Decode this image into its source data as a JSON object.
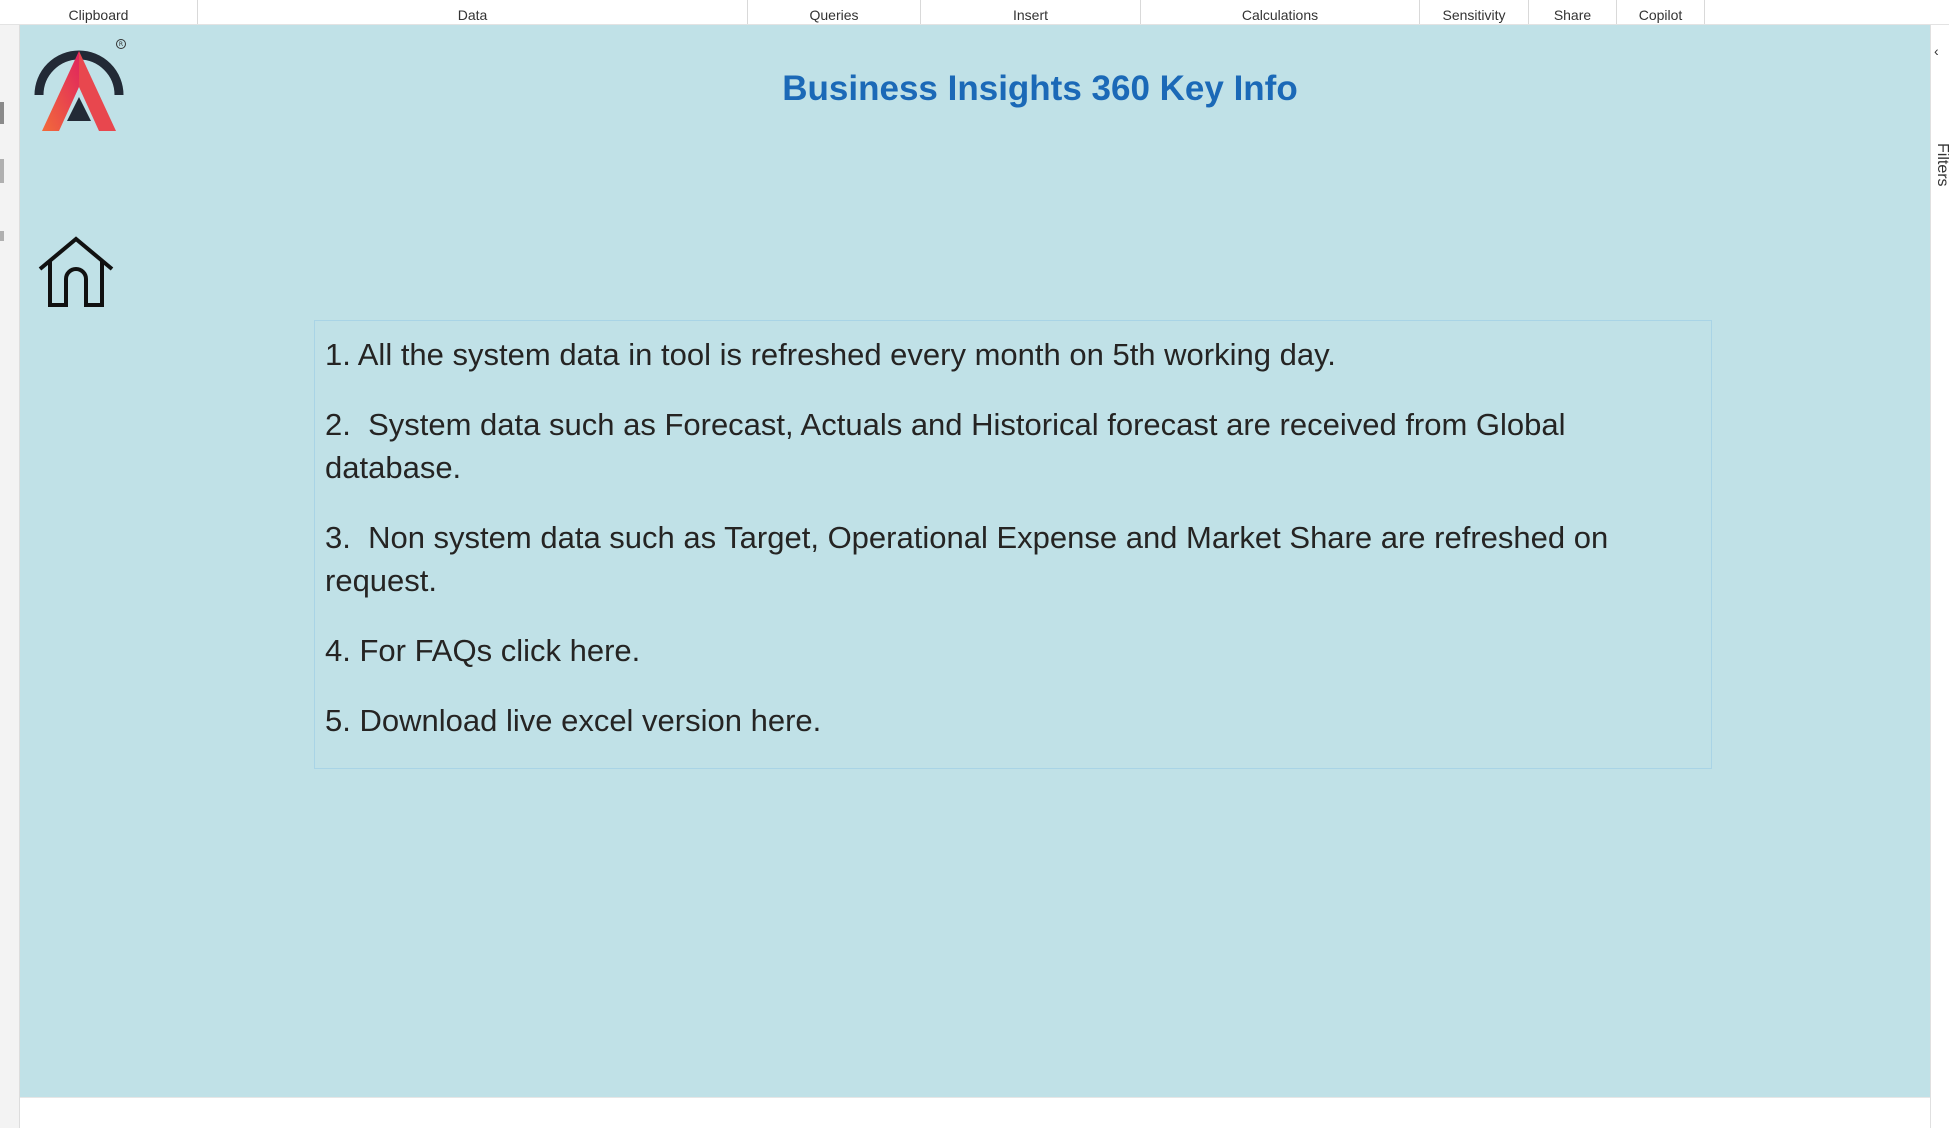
{
  "ribbon": {
    "groups": [
      "Clipboard",
      "Data",
      "Queries",
      "Insert",
      "Calculations",
      "Sensitivity",
      "Share",
      "Copilot"
    ]
  },
  "report": {
    "title": "Business Insights 360 Key Info",
    "info_items": [
      "1. All the system data in tool is refreshed every month on 5th working day.",
      "2.  System data such as Forecast, Actuals and Historical forecast are received from Global database.",
      "3.  Non system data such as Target, Operational Expense and Market Share are refreshed on request.",
      "4. For FAQs click here.",
      "5. Download live excel version here."
    ]
  },
  "right_pane": {
    "label": "Filters",
    "collapse_icon": "chevron-left-icon"
  },
  "icons": {
    "logo": "atliq-logo-icon",
    "home": "home-icon"
  },
  "colors": {
    "canvas_background": "#c0e1e7",
    "title": "#1b69b7",
    "body_text": "#252423",
    "logo_gradient_start": "#f26b3a",
    "logo_gradient_end": "#e0245e"
  }
}
